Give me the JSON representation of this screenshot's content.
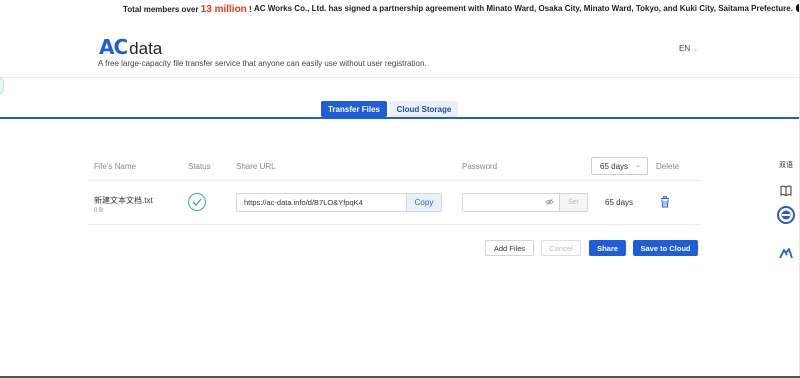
{
  "announcement": {
    "prefix": "Total members over",
    "number": "13 million",
    "suffix": "!",
    "message": "AC Works Co., Ltd. has signed a partnership agreement with Minato Ward, Osaka City, Minato Ward, Tokyo, and Kuki City, Saitama Prefecture."
  },
  "header": {
    "logo_ac": "AC",
    "logo_data": "data",
    "tagline": "A free large-capacity file transfer service that anyone can easily use without user registration.",
    "language": "EN",
    "language_caret": "⌄"
  },
  "tabs": [
    {
      "label": "Transfer Files",
      "active": true
    },
    {
      "label": "Cloud Storage",
      "active": false
    }
  ],
  "table": {
    "columns": {
      "file_name": "File's Name",
      "status": "Status",
      "share_url": "Share URL",
      "password": "Password",
      "delete": "Delete"
    },
    "expiry_select": {
      "value": "65 days",
      "chevron": "⌄"
    },
    "rows": [
      {
        "file_name": "新建文本文档.txt",
        "file_size": "0 B",
        "share_url": "https://ac-data.info/d/B7LO&YfpqK4",
        "copy_label": "Copy",
        "password_value": "",
        "set_label": "Set",
        "expiry": "65 days"
      }
    ]
  },
  "actions": {
    "add_files": "Add Files",
    "cancel": "Cancel",
    "share": "Share",
    "save_to_cloud": "Save to Cloud"
  },
  "sidebar": {
    "translate_label": "双语"
  },
  "colors": {
    "brand_blue": "#1f5ed8",
    "success_green": "#2fb58a",
    "highlight_red": "#e03a1f"
  },
  "icons": [
    "check-circle-icon",
    "eye-off-icon",
    "trash-icon",
    "book-icon",
    "translate-icon",
    "ai-assistant-icon"
  ]
}
